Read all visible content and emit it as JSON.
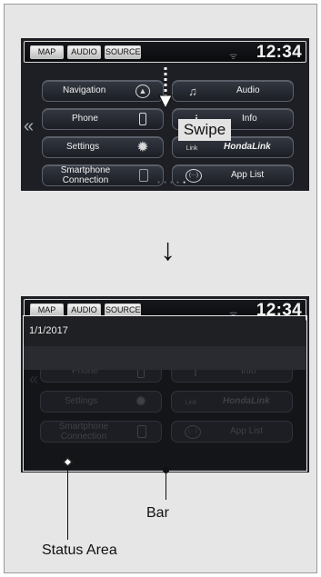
{
  "top_screen": {
    "topbar": {
      "map": "MAP",
      "audio": "AUDIO",
      "source": "SOURCE",
      "clock": "12:34"
    },
    "tiles": [
      {
        "label": "Navigation",
        "icon": "compass-icon"
      },
      {
        "label": "Audio",
        "icon": "music-note-icon"
      },
      {
        "label": "Phone",
        "icon": "phone-icon"
      },
      {
        "label": "Info",
        "icon": "info-icon"
      },
      {
        "label": "Settings",
        "icon": "gear-icon"
      },
      {
        "label": "HondaLink",
        "icon": "link-icon",
        "icon_text": "Link"
      },
      {
        "label": "Smartphone Connection",
        "icon": "smartphone-icon"
      },
      {
        "label": "App List",
        "icon": "app-list-icon",
        "icon_text": "(···)"
      }
    ],
    "swipe_label": "Swipe",
    "page_indicator": {
      "pages": 5,
      "active": 5
    }
  },
  "transition_arrow": "↓",
  "bottom_screen": {
    "topbar": {
      "map": "MAP",
      "audio": "AUDIO",
      "source": "SOURCE",
      "clock": "12:34"
    },
    "status_date": "1/1/2017",
    "dimmed_tiles": [
      {
        "label": "Phone"
      },
      {
        "label": "Info"
      },
      {
        "label": "Settings"
      },
      {
        "label": "HondaLink",
        "icon_text": "Link"
      },
      {
        "label": "Smartphone Connection"
      },
      {
        "label": "App List",
        "icon_text": "(···)"
      }
    ]
  },
  "callouts": {
    "bar": "Bar",
    "status_area": "Status Area"
  },
  "colors": {
    "screen_bg": "#1d1f24",
    "frame_bg": "#e6e6e6",
    "tile_border": "#5c606a",
    "text_light": "#f0f0f0"
  }
}
